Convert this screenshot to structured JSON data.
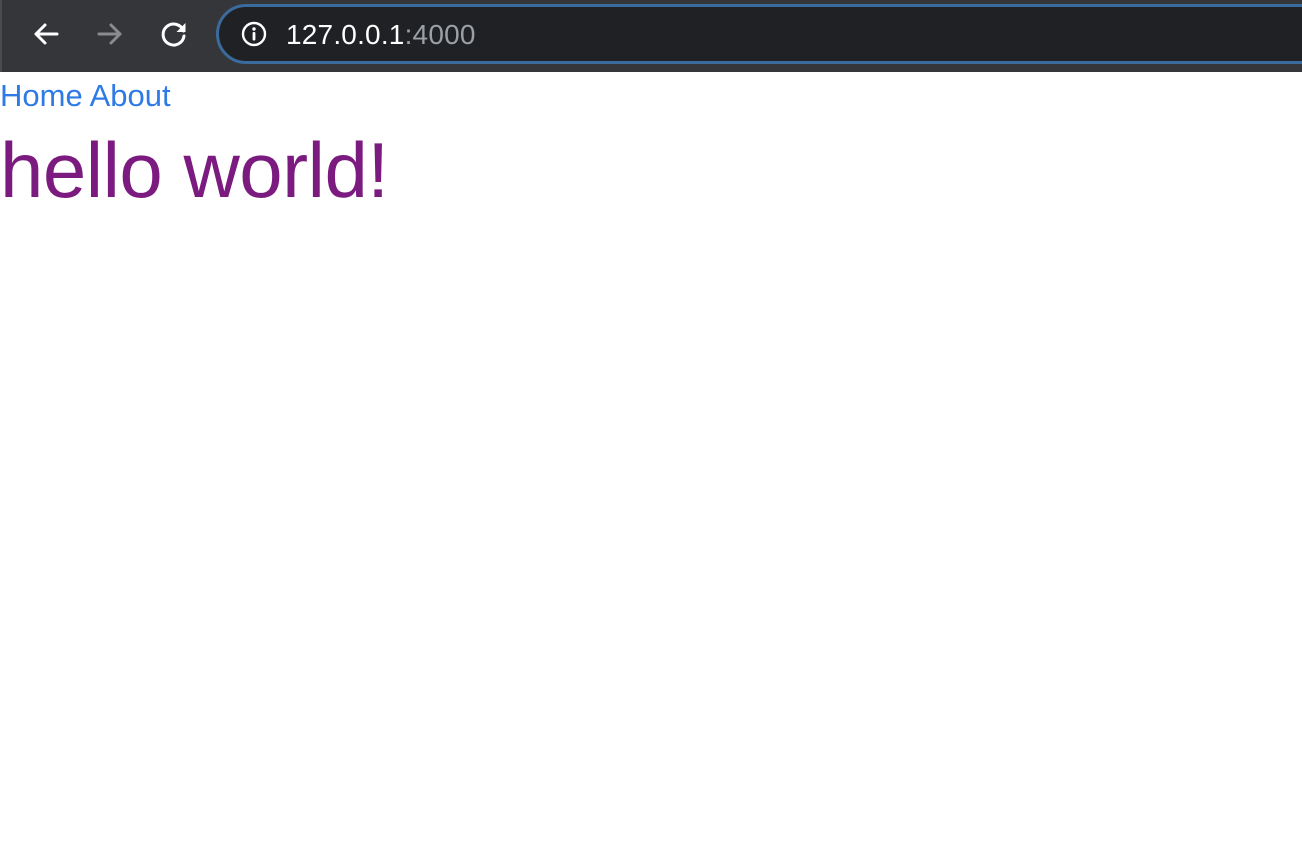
{
  "browser": {
    "url_host": "127.0.0.1",
    "url_port": ":4000",
    "icons": {
      "back": "back-arrow-icon",
      "forward": "forward-arrow-icon",
      "reload": "reload-icon",
      "site_info": "info-icon"
    },
    "colors": {
      "toolbar_bg": "#35363a",
      "omnibox_bg": "#202124",
      "omnibox_border": "#3b6a9c",
      "url_host": "#ffffff",
      "url_port": "#9aa0a6"
    }
  },
  "page": {
    "nav": {
      "links": [
        "Home",
        "About"
      ]
    },
    "heading": "hello world!",
    "colors": {
      "link": "#2f7be6",
      "heading": "#7b1a7f",
      "background": "#ffffff"
    }
  }
}
